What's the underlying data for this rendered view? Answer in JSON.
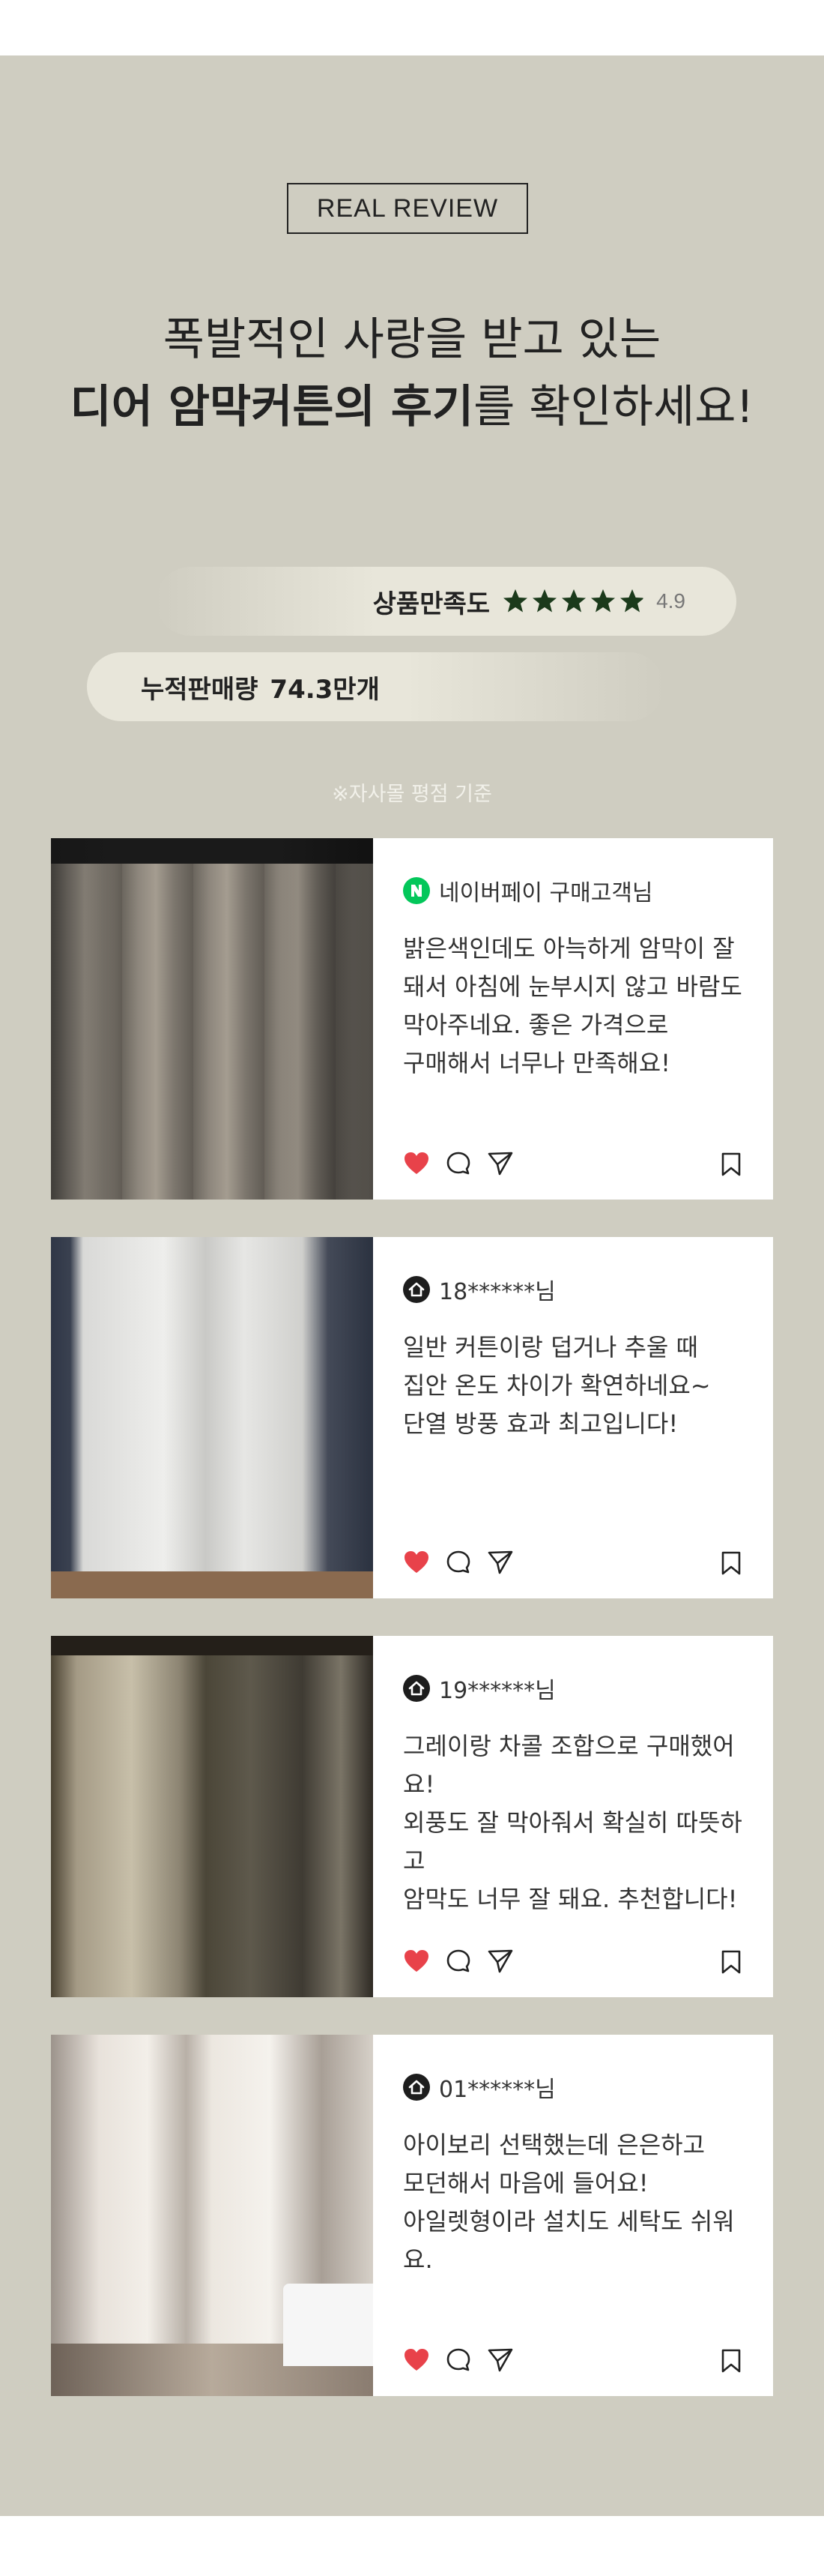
{
  "header": {
    "badge": "REAL REVIEW",
    "headline_line1": "폭발적인 사랑을 받고 있는",
    "headline_line2_bold": "디어 암막커튼의 후기",
    "headline_line2_rest": "를 확인하세요!"
  },
  "rating": {
    "label": "상품만족도",
    "stars": 4.9,
    "value": "4.9"
  },
  "sales": {
    "label": "누적판매량",
    "value": "74.3만개"
  },
  "note": "※자사몰 평점 기준",
  "colors": {
    "background": "#cfcdc1",
    "card": "#ffffff",
    "heart": "#e8424a",
    "star": "#1b3a1b",
    "naver": "#03c75a"
  },
  "reviews": [
    {
      "source_icon": "naver-icon",
      "reviewer": "네이버페이 구매고객님",
      "text": "밝은색인데도 아늑하게 암막이 잘\n돼서 아침에 눈부시지 않고 바람도\n막아주네요. 좋은 가격으로\n구매해서 너무나 만족해요!"
    },
    {
      "source_icon": "house-icon",
      "reviewer": "18******님",
      "text": "일반 커튼이랑 덥거나 추울 때\n집안 온도 차이가 확연하네요~\n단열 방풍 효과 최고입니다!"
    },
    {
      "source_icon": "house-icon",
      "reviewer": "19******님",
      "text": "그레이랑 차콜 조합으로 구매했어요!\n외풍도 잘 막아줘서 확실히 따뜻하고\n암막도 너무 잘 돼요. 추천합니다!"
    },
    {
      "source_icon": "house-icon",
      "reviewer": "01******님",
      "text": "아이보리 선택했는데 은은하고\n모던해서 마음에 들어요!\n아일렛형이라 설치도 세탁도 쉬워요."
    }
  ]
}
